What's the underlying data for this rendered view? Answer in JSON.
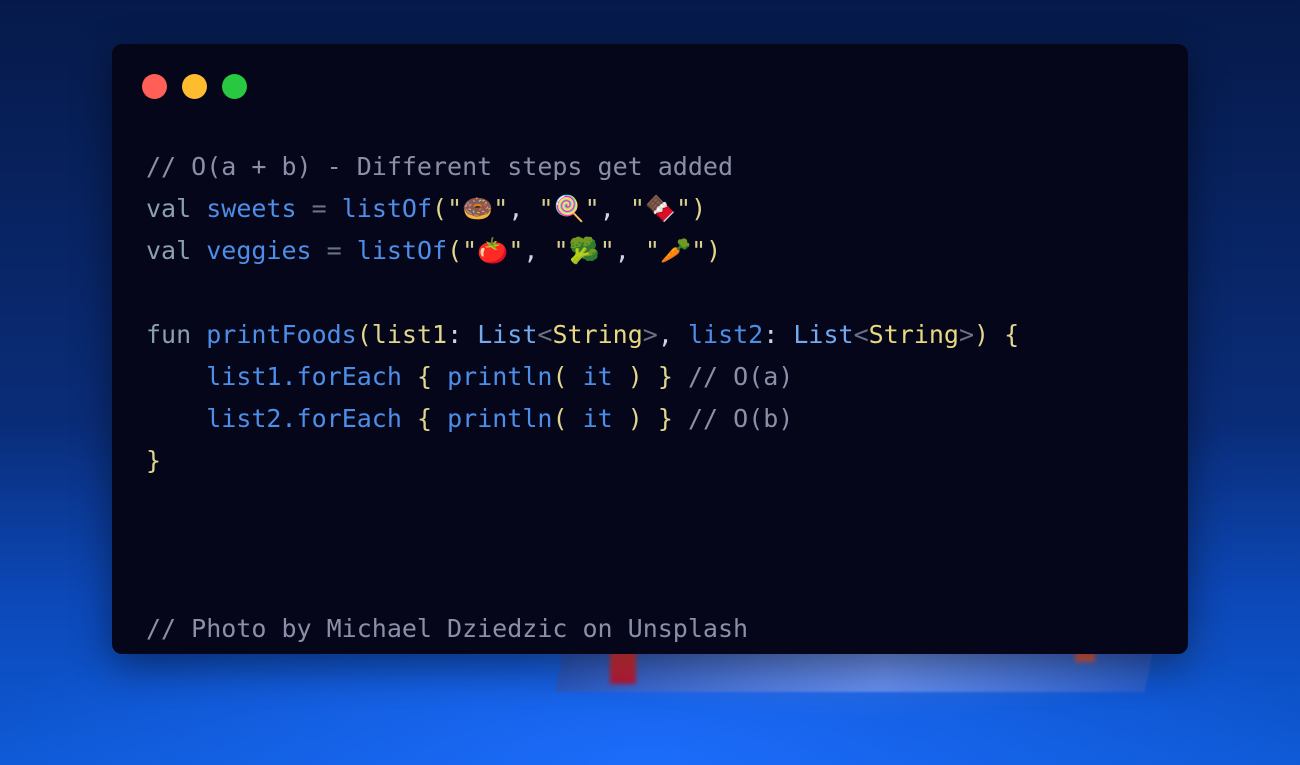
{
  "window": {
    "controls": {
      "close_color": "#ff5f57",
      "minimize_color": "#febc2e",
      "maximize_color": "#28c840"
    }
  },
  "code": {
    "line1": {
      "comment": "// O(a + b) - Different steps get added"
    },
    "line2": {
      "keyword": "val",
      "name": "sweets",
      "op": "=",
      "func": "listOf",
      "open": "(",
      "items": [
        "🍩",
        "🍭",
        "🍫"
      ],
      "close": ")"
    },
    "line3": {
      "keyword": "val",
      "name": "veggies",
      "op": "=",
      "func": "listOf",
      "open": "(",
      "items": [
        "🍅",
        "🥦",
        "🥕"
      ],
      "close": ")"
    },
    "line5": {
      "keyword": "fun",
      "func": "printFoods",
      "open": "(",
      "param1": "list1",
      "param2": "list2",
      "colon": ":",
      "type": "List",
      "type_arg": "String",
      "lt": "<",
      "gt": ">",
      "comma": ",",
      "close": ")",
      "brace": "{"
    },
    "line6": {
      "receiver": "list1",
      "call": ".forEach",
      "open_brace": "{",
      "func": "println",
      "open": "(",
      "arg": "it",
      "close": ")",
      "close_brace": "}",
      "comment": "// O(a)"
    },
    "line7": {
      "receiver": "list2",
      "call": ".forEach",
      "open_brace": "{",
      "func": "println",
      "open": "(",
      "arg": "it",
      "close": ")",
      "close_brace": "}",
      "comment": "// O(b)"
    },
    "line8": {
      "brace": "}"
    },
    "credit": {
      "comment": "// Photo by Michael Dziedzic on Unsplash"
    }
  }
}
